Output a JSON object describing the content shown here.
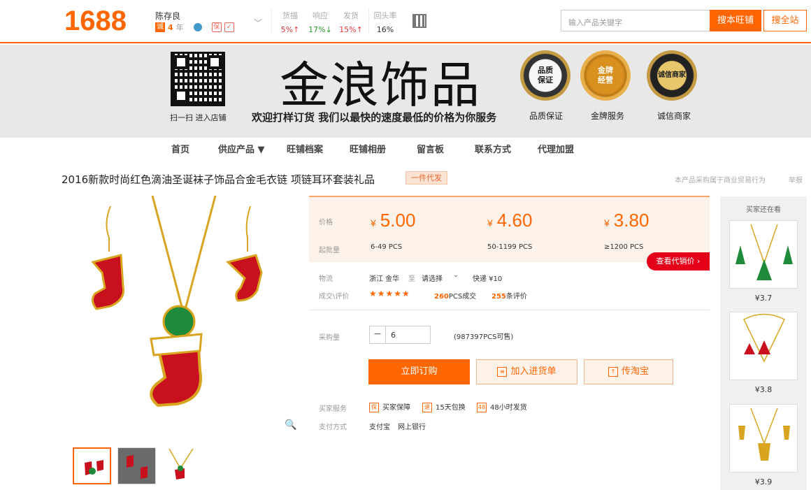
{
  "header": {
    "logo": "1688",
    "seller_name": "陈存良",
    "cheng_badge": "诚",
    "years": "4",
    "years_unit": "年",
    "badge_b": "保",
    "stats": [
      {
        "label": "货描",
        "value": "5%↑",
        "color": "#e4393c"
      },
      {
        "label": "响应",
        "value": "17%↓",
        "color": "#2a9a2a"
      },
      {
        "label": "发货",
        "value": "15%↑",
        "color": "#e4393c"
      },
      {
        "label": "回头率",
        "value": "16%",
        "color": "#333333"
      }
    ],
    "search_placeholder": "输入产品关键字",
    "search_shop_label": "搜本旺铺",
    "search_all_label": "搜全站"
  },
  "banner": {
    "qr_caption": "扫一扫 进入店铺",
    "shop_name": "金浪饰品",
    "slogan": "欢迎打样订货 我们以最快的速度最低的价格为你服务",
    "medals": [
      {
        "text": "品质\n保证",
        "caption": "品质保证"
      },
      {
        "text": "金牌\n经营",
        "caption": "金牌服务"
      },
      {
        "text": "诚信商家",
        "caption": "诚信商家"
      }
    ]
  },
  "nav": {
    "items": [
      "首页",
      "供应产品 ▼",
      "旺铺档案",
      "旺铺相册",
      "留言板",
      "联系方式",
      "代理加盟"
    ]
  },
  "product": {
    "title": "2016新款时尚红色滴油圣诞袜子饰品合金毛衣链 项链耳环套装礼品",
    "tag": "一件代发",
    "note": "本产品采购属于商业贸易行为",
    "report": "举报",
    "price_label": "价格",
    "range_label": "起批量",
    "currency": "¥",
    "prices": [
      {
        "price": "5.00",
        "range": "6-49 PCS"
      },
      {
        "price": "4.60",
        "range": "50-1199 PCS"
      },
      {
        "price": "3.80",
        "range": "≥1200 PCS"
      }
    ],
    "agent_price_label": "查看代销价 ›",
    "logistics_label": "物流",
    "logistics_from": "浙江 金华",
    "logistics_to_word": "至",
    "logistics_select": "请选择",
    "express": "快递 ¥10",
    "trade_label": "成交\\评价",
    "stars": "★★★★★",
    "sold_count": "260",
    "sold_unit": "PCS成交",
    "review_count": "255",
    "review_unit": "条评价",
    "qty_label": "采购量",
    "qty_minus": "−",
    "qty_value": "6",
    "stock": "(987397PCS可售)",
    "buy_label": "立即订购",
    "cart_label": "加入进货单",
    "taobao_label": "传淘宝",
    "service_label": "买家服务",
    "services": [
      "买家保障",
      "15天包换",
      "48小时发货"
    ],
    "service_icons": [
      "保",
      "退",
      "48"
    ],
    "pay_label": "支付方式",
    "pay_methods": [
      "支付宝",
      "网上银行"
    ]
  },
  "sidebar": {
    "title": "买家还在看",
    "items": [
      {
        "price": "¥3.7"
      },
      {
        "price": "¥3.8"
      },
      {
        "price": "¥3.9"
      }
    ]
  },
  "colors": {
    "accent": "#ff6600",
    "agent_red": "#e5001a",
    "banner_bg": "#e8e8e8"
  }
}
